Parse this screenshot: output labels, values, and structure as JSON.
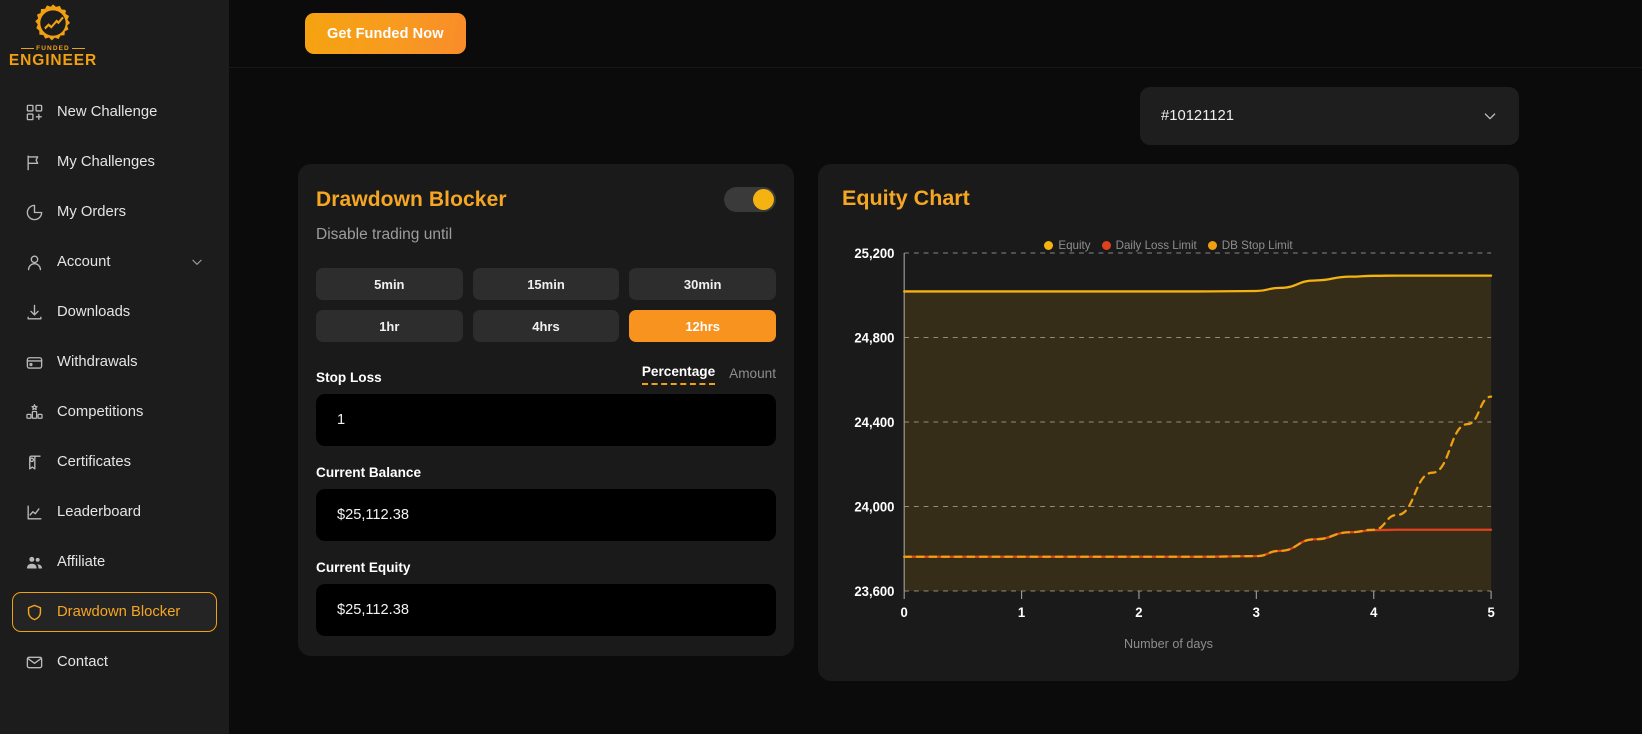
{
  "brand": {
    "sub": "FUNDED",
    "name": "ENGINEER",
    "accent": "#f0a010",
    "logo_icon": "gear-chart-logo-icon"
  },
  "sidebar": {
    "items": [
      {
        "label": "New Challenge",
        "icon": "grid-plus-icon",
        "active": false,
        "chevron": false
      },
      {
        "label": "My Challenges",
        "icon": "flag-icon",
        "active": false,
        "chevron": false
      },
      {
        "label": "My Orders",
        "icon": "pie-chart-icon",
        "active": false,
        "chevron": false
      },
      {
        "label": "Account",
        "icon": "user-icon",
        "active": false,
        "chevron": true
      },
      {
        "label": "Downloads",
        "icon": "download-icon",
        "active": false,
        "chevron": false
      },
      {
        "label": "Withdrawals",
        "icon": "wallet-icon",
        "active": false,
        "chevron": false
      },
      {
        "label": "Competitions",
        "icon": "podium-icon",
        "active": false,
        "chevron": false
      },
      {
        "label": "Certificates",
        "icon": "certificate-icon",
        "active": false,
        "chevron": false
      },
      {
        "label": "Leaderboard",
        "icon": "line-chart-icon",
        "active": false,
        "chevron": false
      },
      {
        "label": "Affiliate",
        "icon": "users-icon",
        "active": false,
        "chevron": false
      },
      {
        "label": "Drawdown Blocker",
        "icon": "shield-icon",
        "active": true,
        "chevron": false
      },
      {
        "label": "Contact",
        "icon": "envelope-icon",
        "active": false,
        "chevron": false
      }
    ]
  },
  "topbar": {
    "cta_label": "Get Funded Now"
  },
  "account_select": {
    "value": "#10121121",
    "icon": "chevron-down-icon"
  },
  "drawdown_blocker": {
    "title": "Drawdown Blocker",
    "enabled": true,
    "subtitle": "Disable trading until",
    "durations": [
      {
        "label": "5min",
        "selected": false
      },
      {
        "label": "15min",
        "selected": false
      },
      {
        "label": "30min",
        "selected": false
      },
      {
        "label": "1hr",
        "selected": false
      },
      {
        "label": "4hrs",
        "selected": false
      },
      {
        "label": "12hrs",
        "selected": true
      }
    ],
    "stop_loss": {
      "label": "Stop Loss",
      "value": "1",
      "modes": [
        {
          "label": "Percentage",
          "selected": true
        },
        {
          "label": "Amount",
          "selected": false
        }
      ]
    },
    "current_balance": {
      "label": "Current Balance",
      "value": "$25,112.38"
    },
    "current_equity": {
      "label": "Current Equity",
      "value": "$25,112.38"
    }
  },
  "equity_chart": {
    "title": "Equity Chart"
  },
  "chart_data": {
    "type": "line",
    "title": "Equity Chart",
    "xlabel": "Number of days",
    "ylabel": "",
    "xlim": [
      0,
      5
    ],
    "ylim": [
      23600,
      25200
    ],
    "xticks": [
      "0",
      "1",
      "2",
      "3",
      "4",
      "5"
    ],
    "yticks": [
      "23,600",
      "24,000",
      "24,400",
      "24,800",
      "25,200"
    ],
    "grid": true,
    "legend_position": "top-center",
    "x": [
      0,
      0.5,
      1,
      1.5,
      2,
      2.5,
      3,
      3.2,
      3.5,
      3.8,
      4,
      4.2,
      4.5,
      4.8,
      5
    ],
    "series": [
      {
        "name": "Equity",
        "color": "#f5b312",
        "style": "solid",
        "fill": true,
        "values": [
          25018,
          25018,
          25018,
          25018,
          25018,
          25018,
          25020,
          25035,
          25070,
          25088,
          25092,
          25093,
          25093,
          25093,
          25093
        ]
      },
      {
        "name": "Daily Loss Limit",
        "color": "#e0401a",
        "style": "solid",
        "values": [
          23762,
          23762,
          23762,
          23762,
          23762,
          23762,
          23765,
          23790,
          23845,
          23878,
          23888,
          23890,
          23890,
          23890,
          23890
        ]
      },
      {
        "name": "DB Stop Limit",
        "color": "#f0a010",
        "style": "dashed",
        "values": [
          23762,
          23762,
          23762,
          23762,
          23762,
          23762,
          23765,
          23790,
          23845,
          23878,
          23890,
          23960,
          24160,
          24390,
          24520
        ]
      }
    ]
  }
}
